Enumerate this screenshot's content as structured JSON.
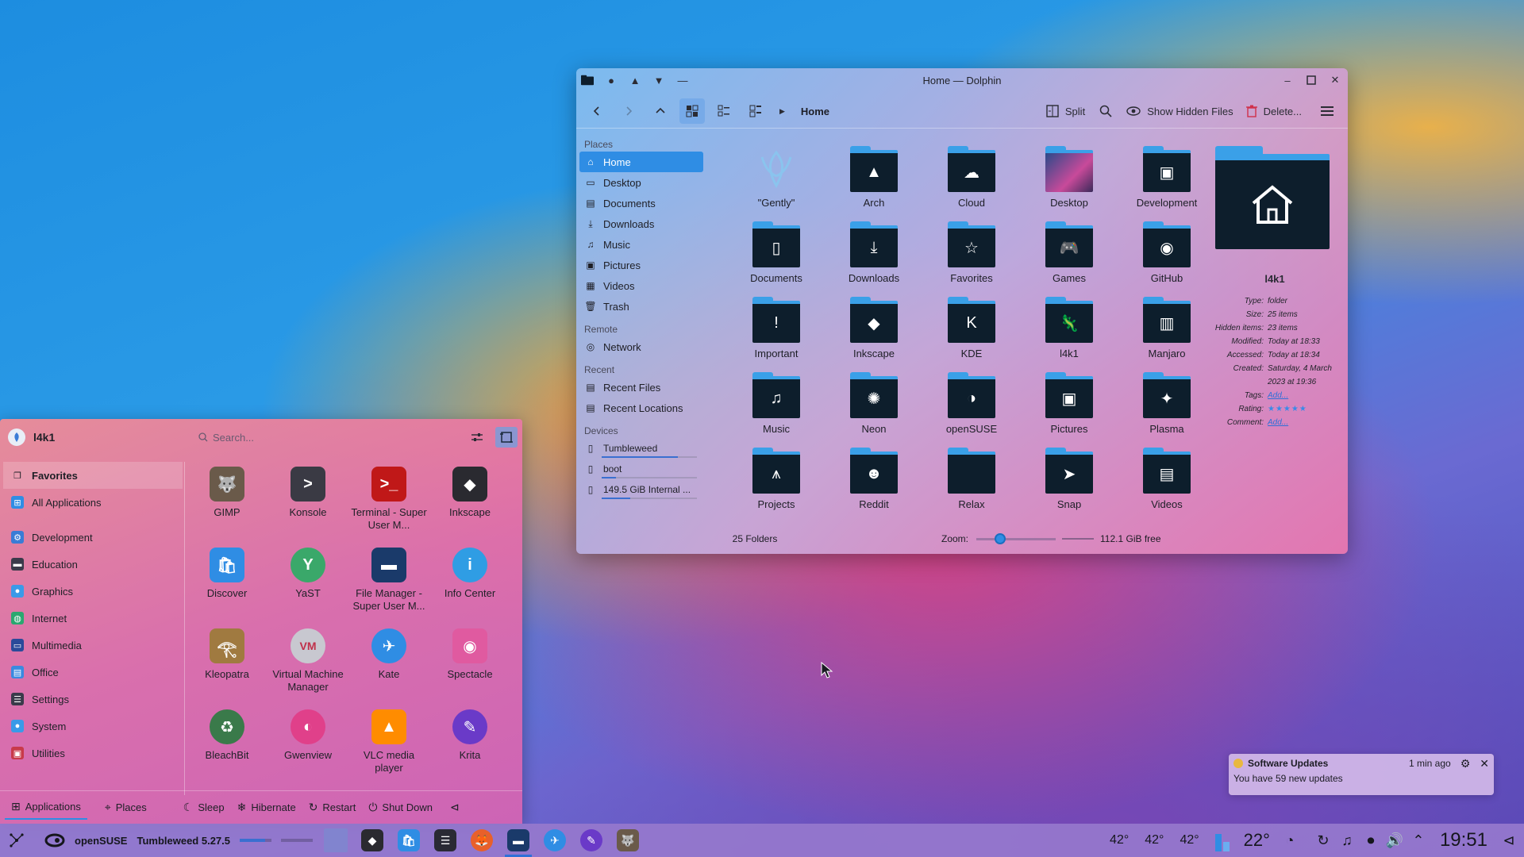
{
  "dolphin": {
    "title": "Home — Dolphin",
    "toolbar": {
      "breadcrumb": "Home",
      "split_label": "Split",
      "show_hidden_label": "Show Hidden Files",
      "delete_label": "Delete..."
    },
    "places": {
      "sections": [
        {
          "title": "Places",
          "items": [
            {
              "label": "Home",
              "icon": "home-icon",
              "selected": true
            },
            {
              "label": "Desktop",
              "icon": "desktop-icon"
            },
            {
              "label": "Documents",
              "icon": "documents-icon"
            },
            {
              "label": "Downloads",
              "icon": "downloads-icon"
            },
            {
              "label": "Music",
              "icon": "music-icon"
            },
            {
              "label": "Pictures",
              "icon": "pictures-icon"
            },
            {
              "label": "Videos",
              "icon": "videos-icon"
            },
            {
              "label": "Trash",
              "icon": "trash-icon"
            }
          ]
        },
        {
          "title": "Remote",
          "items": [
            {
              "label": "Network",
              "icon": "network-icon"
            }
          ]
        },
        {
          "title": "Recent",
          "items": [
            {
              "label": "Recent Files",
              "icon": "recent-files-icon"
            },
            {
              "label": "Recent Locations",
              "icon": "recent-locations-icon"
            }
          ]
        },
        {
          "title": "Devices",
          "items": [
            {
              "label": "Tumbleweed",
              "icon": "drive-icon",
              "usage": 0.8
            },
            {
              "label": "boot",
              "icon": "drive-icon",
              "usage": 0.15
            },
            {
              "label": "149.5 GiB Internal ...",
              "icon": "drive-icon",
              "usage": 0.3
            }
          ]
        }
      ]
    },
    "folders": [
      {
        "name": "\"Gently\"",
        "icon": "gently-icon"
      },
      {
        "name": "Arch",
        "icon": "arch-icon"
      },
      {
        "name": "Cloud",
        "icon": "cloud-icon"
      },
      {
        "name": "Desktop",
        "icon": "desktop-folder-icon"
      },
      {
        "name": "Development",
        "icon": "development-icon"
      },
      {
        "name": "Documents",
        "icon": "documents-folder-icon"
      },
      {
        "name": "Downloads",
        "icon": "downloads-folder-icon"
      },
      {
        "name": "Favorites",
        "icon": "star-icon"
      },
      {
        "name": "Games",
        "icon": "gamepad-icon"
      },
      {
        "name": "GitHub",
        "icon": "github-icon"
      },
      {
        "name": "Important",
        "icon": "exclamation-icon"
      },
      {
        "name": "Inkscape",
        "icon": "inkscape-icon"
      },
      {
        "name": "KDE",
        "icon": "kde-icon"
      },
      {
        "name": "l4k1",
        "icon": "chameleon-icon"
      },
      {
        "name": "Manjaro",
        "icon": "manjaro-icon"
      },
      {
        "name": "Music",
        "icon": "music-folder-icon"
      },
      {
        "name": "Neon",
        "icon": "neon-icon"
      },
      {
        "name": "openSUSE",
        "icon": "opensuse-icon"
      },
      {
        "name": "Pictures",
        "icon": "pictures-folder-icon"
      },
      {
        "name": "Plasma",
        "icon": "plasma-icon"
      },
      {
        "name": "Projects",
        "icon": "compass-icon"
      },
      {
        "name": "Reddit",
        "icon": "reddit-icon"
      },
      {
        "name": "Relax",
        "icon": "folder-icon"
      },
      {
        "name": "Snap",
        "icon": "snap-icon"
      },
      {
        "name": "Videos",
        "icon": "film-icon"
      }
    ],
    "info": {
      "name": "l4k1",
      "rows": [
        {
          "k": "Type:",
          "v": "folder"
        },
        {
          "k": "Size:",
          "v": "25 items"
        },
        {
          "k": "Hidden items:",
          "v": "23 items"
        },
        {
          "k": "Modified:",
          "v": "Today at 18:33"
        },
        {
          "k": "Accessed:",
          "v": "Today at 18:34"
        },
        {
          "k": "Created:",
          "v": "Saturday, 4 March 2023 at 19:36"
        },
        {
          "k": "Tags:",
          "v": "Add...",
          "link": true
        },
        {
          "k": "Rating:",
          "v": "★★★★★",
          "stars": true
        },
        {
          "k": "Comment:",
          "v": "Add...",
          "link": true
        }
      ]
    },
    "status": {
      "count": "25 Folders",
      "zoom_label": "Zoom:",
      "zoom_level": 0.3,
      "free": "112.1 GiB free"
    }
  },
  "launcher": {
    "user": "l4k1",
    "search_placeholder": "Search...",
    "categories": [
      {
        "label": "Favorites",
        "icon": "bookmark-icon",
        "color": "#00000000",
        "selected": true
      },
      {
        "label": "All Applications",
        "icon": "grid-icon",
        "color": "#2f8de4"
      },
      {
        "gap": true
      },
      {
        "label": "Development",
        "icon": "development-icon",
        "color": "#3a7cd6"
      },
      {
        "label": "Education",
        "icon": "education-icon",
        "color": "#3a3a4a"
      },
      {
        "label": "Graphics",
        "icon": "graphics-icon",
        "color": "#3a9ae8"
      },
      {
        "label": "Internet",
        "icon": "internet-icon",
        "color": "#2aa870"
      },
      {
        "label": "Multimedia",
        "icon": "multimedia-icon",
        "color": "#2a4a9a"
      },
      {
        "label": "Office",
        "icon": "office-icon",
        "color": "#3a8ae0"
      },
      {
        "label": "Settings",
        "icon": "settings-icon",
        "color": "#3a3a4a"
      },
      {
        "label": "System",
        "icon": "system-icon",
        "color": "#3a9ae8"
      },
      {
        "label": "Utilities",
        "icon": "utilities-icon",
        "color": "#c83a4a"
      }
    ],
    "apps": [
      {
        "name": "GIMP",
        "icon": "gimp-icon",
        "color": "#6a5a4a",
        "glyph": "🐺"
      },
      {
        "name": "Konsole",
        "icon": "konsole-icon",
        "color": "#3a3a44",
        "glyph": ">"
      },
      {
        "name": "Terminal - Super User M...",
        "icon": "terminal-icon",
        "color": "#c01818",
        "glyph": ">_"
      },
      {
        "name": "Inkscape",
        "icon": "inkscape-icon",
        "color": "#2a2a30",
        "glyph": "◆"
      },
      {
        "name": "Discover",
        "icon": "discover-icon",
        "color": "#2f8de4",
        "glyph": "🛍"
      },
      {
        "name": "YaST",
        "icon": "yast-icon",
        "color": "#3aa86a",
        "glyph": "Y"
      },
      {
        "name": "File Manager - Super User M...",
        "icon": "file-manager-icon",
        "color": "#1a3a6a",
        "glyph": "▬"
      },
      {
        "name": "Info Center",
        "icon": "info-icon",
        "color": "#2f9de4",
        "glyph": "i"
      },
      {
        "name": "Kleopatra",
        "icon": "kleopatra-icon",
        "color": "#a07a40",
        "glyph": "𓂀"
      },
      {
        "name": "Virtual Machine Manager",
        "icon": "vmm-icon",
        "color": "#c8c8d0",
        "glyph": "VM"
      },
      {
        "name": "Kate",
        "icon": "kate-icon",
        "color": "#2f8de4",
        "glyph": "✈"
      },
      {
        "name": "Spectacle",
        "icon": "spectacle-icon",
        "color": "#e05aa0",
        "glyph": "◉"
      },
      {
        "name": "BleachBit",
        "icon": "bleachbit-icon",
        "color": "#3a7a4a",
        "glyph": "♻"
      },
      {
        "name": "Gwenview",
        "icon": "gwenview-icon",
        "color": "#e0408a",
        "glyph": "◐"
      },
      {
        "name": "VLC media player",
        "icon": "vlc-icon",
        "color": "#ff8c00",
        "glyph": "▲"
      },
      {
        "name": "Krita",
        "icon": "krita-icon",
        "color": "#6a3ac8",
        "glyph": "✎"
      }
    ],
    "footer": {
      "applications": "Applications",
      "places": "Places",
      "sleep": "Sleep",
      "hibernate": "Hibernate",
      "restart": "Restart",
      "shutdown": "Shut Down"
    }
  },
  "notification": {
    "title": "Software Updates",
    "time": "1 min ago",
    "body": "You have 59 new updates"
  },
  "panel": {
    "distro": "openSUSE",
    "version": "Tumbleweed 5.27.5",
    "temps": [
      "42°",
      "42°",
      "42°"
    ],
    "weather": "22°",
    "clock": "19:51",
    "tasks": [
      {
        "name": "pager",
        "color": "#7a8ad0"
      },
      {
        "name": "inkscape",
        "color": "#2a2a30",
        "glyph": "◆"
      },
      {
        "name": "discover",
        "color": "#2f8de4",
        "glyph": "🛍"
      },
      {
        "name": "system-settings",
        "color": "#2a2a34",
        "glyph": "☰"
      },
      {
        "name": "firefox",
        "color": "#e8602a",
        "glyph": "🦊"
      },
      {
        "name": "dolphin",
        "color": "#1a3a6a",
        "glyph": "▬",
        "active": true
      },
      {
        "name": "kate",
        "color": "#2f8de4",
        "glyph": "✈"
      },
      {
        "name": "krita",
        "color": "#6a3ac8",
        "glyph": "✎"
      },
      {
        "name": "gimp",
        "color": "#6a5a4a",
        "glyph": "🐺"
      }
    ]
  }
}
